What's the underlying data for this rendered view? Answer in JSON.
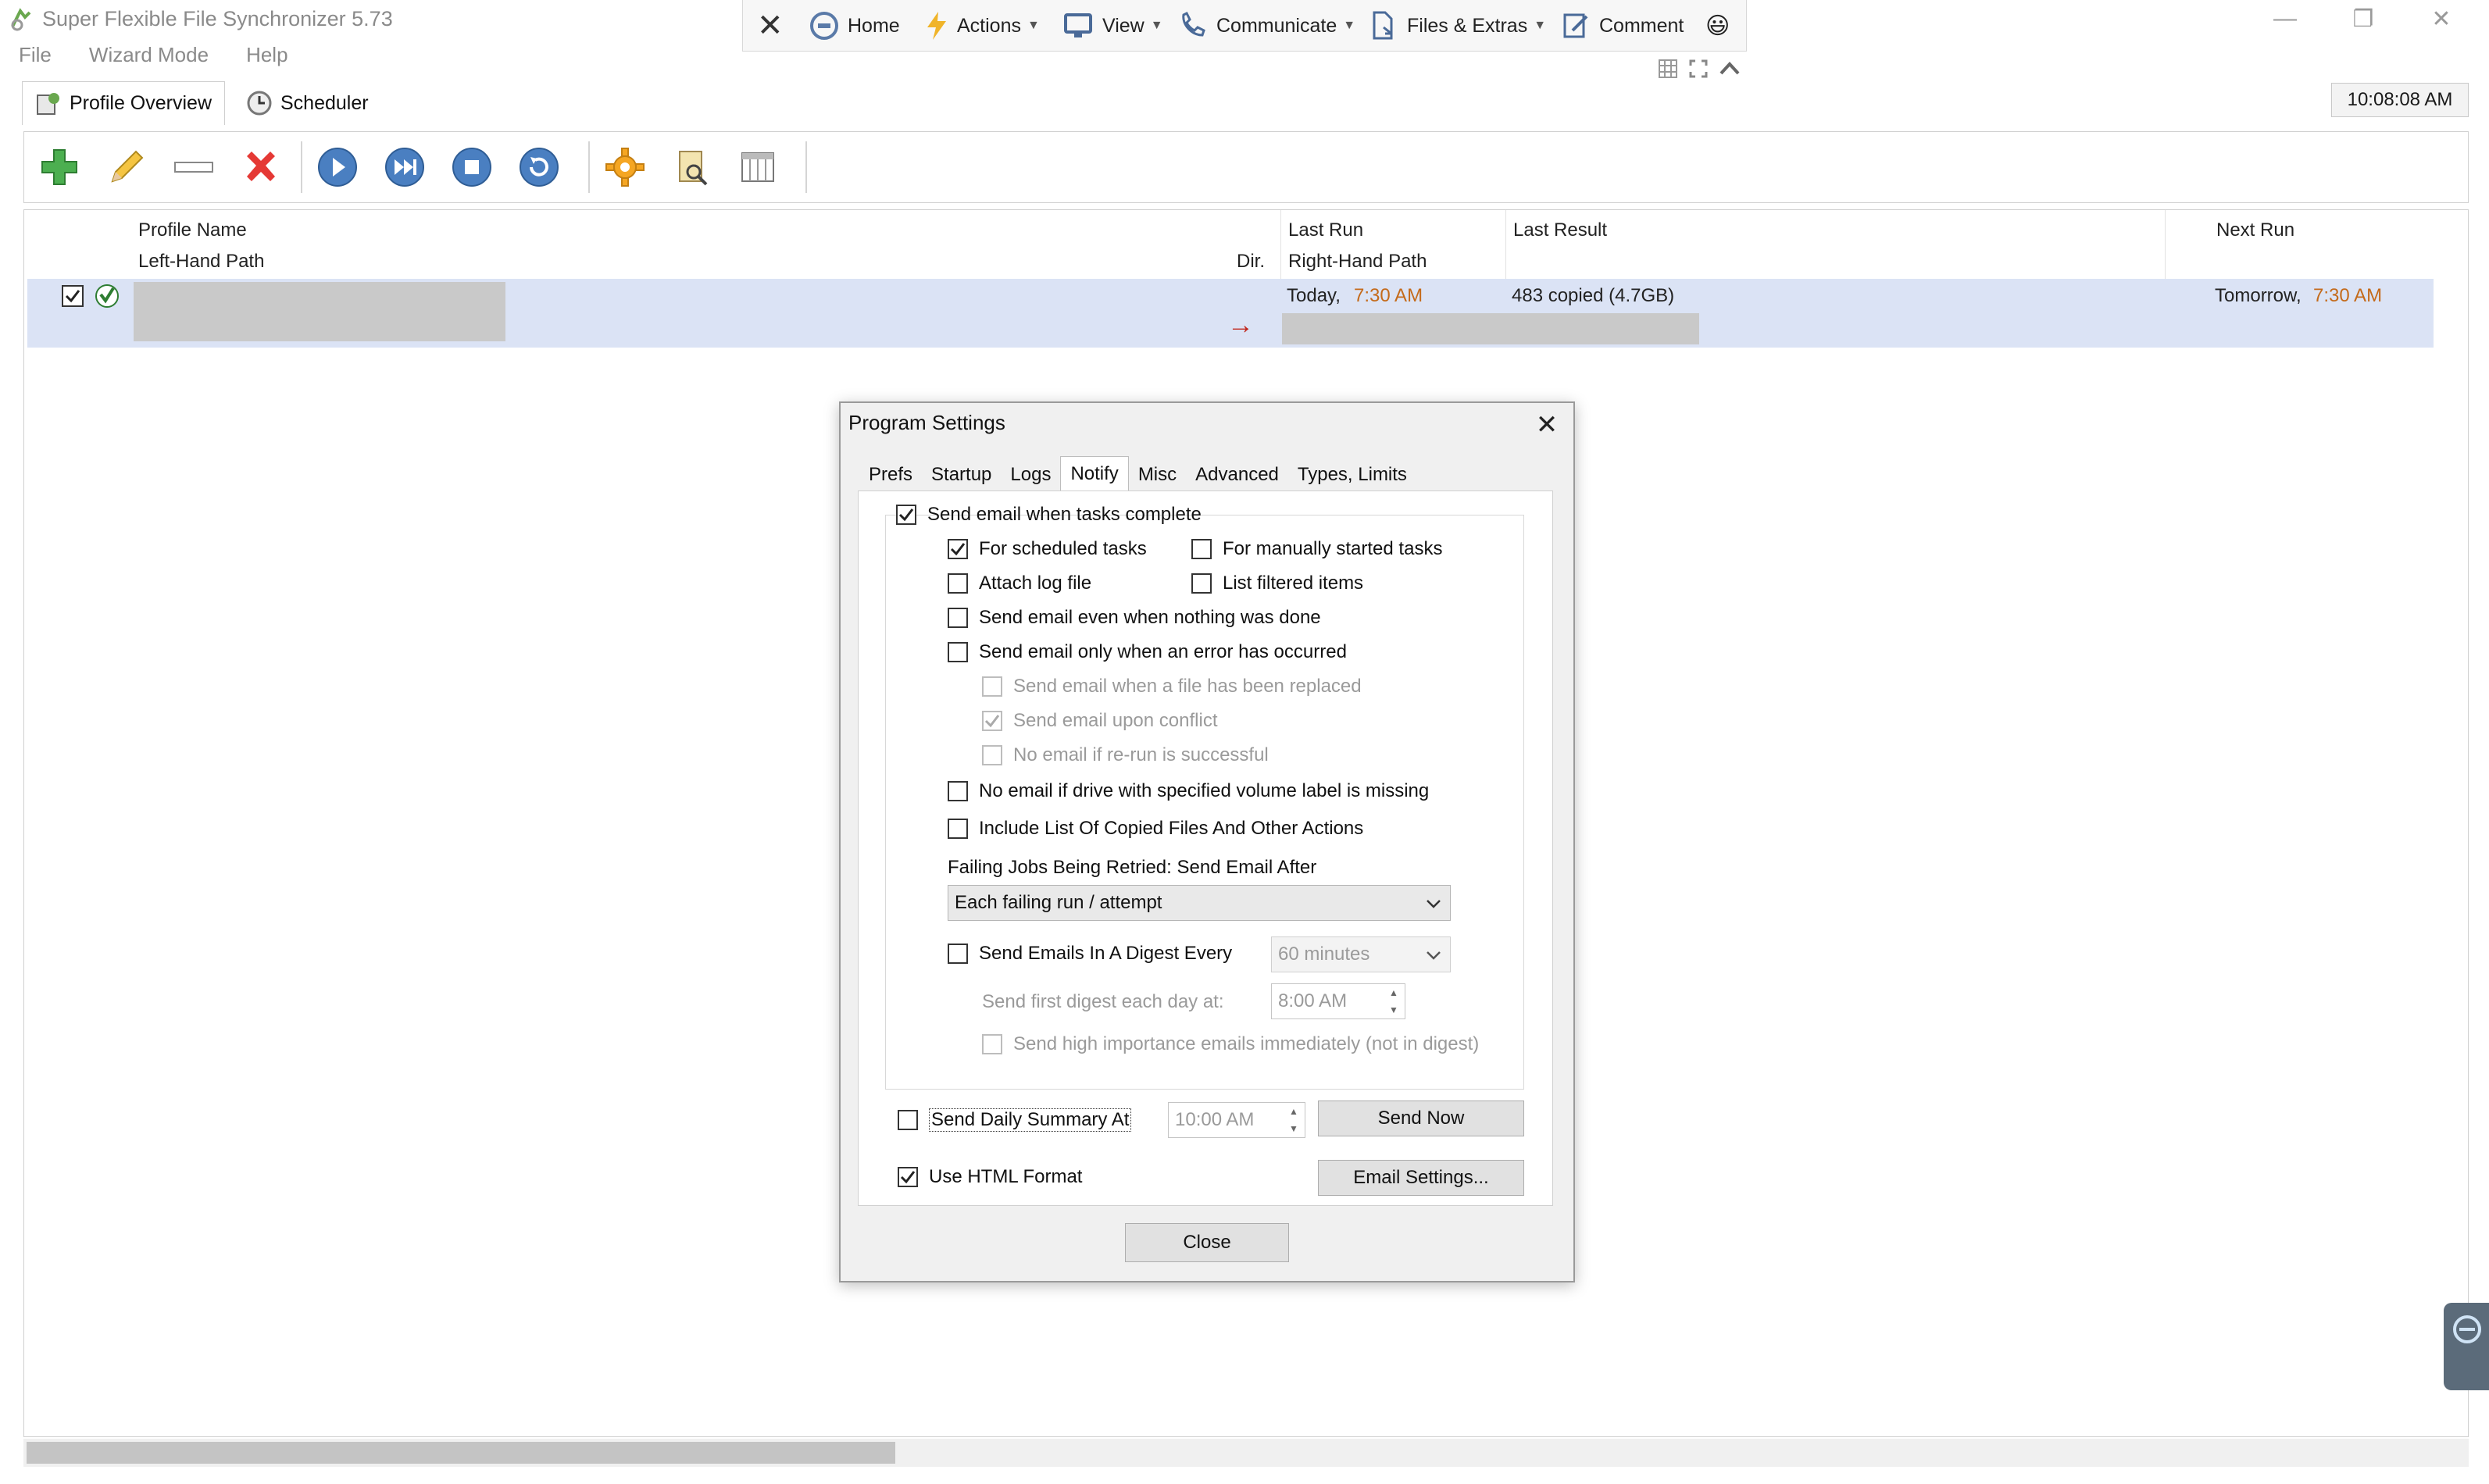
{
  "window": {
    "title": "Super Flexible File Synchronizer 5.73",
    "minimize_glyph": "—",
    "restore_glyph": "❐",
    "close_glyph": "✕"
  },
  "floating_toolbar": {
    "close_glyph": "✕",
    "items": [
      {
        "label": "Home",
        "icon": "home-icon"
      },
      {
        "label": "Actions",
        "icon": "lightning-icon",
        "dropdown": true
      },
      {
        "label": "View",
        "icon": "monitor-icon",
        "dropdown": true
      },
      {
        "label": "Communicate",
        "icon": "phone-icon",
        "dropdown": true
      },
      {
        "label": "Files & Extras",
        "icon": "file-icon",
        "dropdown": true
      },
      {
        "label": "Comment",
        "icon": "edit-icon"
      }
    ],
    "emoji": "😃"
  },
  "menu": [
    "File",
    "Wizard Mode",
    "Help"
  ],
  "view_tabs": {
    "profile_overview": "Profile Overview",
    "scheduler": "Scheduler"
  },
  "clock": "10:08:08 AM",
  "grid": {
    "headers": {
      "profile_name": "Profile Name",
      "left_path": "Left-Hand Path",
      "dir": "Dir.",
      "last_run": "Last Run",
      "right_path": "Right-Hand Path",
      "last_result": "Last Result",
      "next_run": "Next Run"
    },
    "rows": [
      {
        "checked": true,
        "last_run_day": "Today,",
        "last_run_time": "7:30 AM",
        "last_result": "483 copied (4.7GB)",
        "next_run_day": "Tomorrow,",
        "next_run_time": "7:30 AM",
        "direction": "→"
      }
    ]
  },
  "dialog": {
    "title": "Program Settings",
    "close_glyph": "✕",
    "tabs": [
      "Prefs",
      "Startup",
      "Logs",
      "Notify",
      "Misc",
      "Advanced",
      "Types, Limits"
    ],
    "active_tab": "Notify",
    "options": {
      "send_email_complete": {
        "label": "Send email when tasks complete",
        "checked": true
      },
      "for_scheduled": {
        "label": "For scheduled tasks",
        "checked": true
      },
      "for_manual": {
        "label": "For manually started tasks",
        "checked": false
      },
      "attach_log": {
        "label": "Attach log file",
        "checked": false
      },
      "list_filtered": {
        "label": "List filtered items",
        "checked": false
      },
      "send_nothing_done": {
        "label": "Send email even when nothing was done",
        "checked": false
      },
      "send_only_error": {
        "label": "Send email only when an error has occurred",
        "checked": false
      },
      "send_file_replaced": {
        "label": "Send email when a file has been replaced",
        "checked": false
      },
      "send_conflict": {
        "label": "Send email upon conflict",
        "checked": true
      },
      "no_email_rerun": {
        "label": "No email if re-run is successful",
        "checked": false
      },
      "no_email_volume": {
        "label": "No email if drive with specified volume label is missing",
        "checked": false
      },
      "include_list": {
        "label": "Include List Of Copied Files And Other Actions",
        "checked": false
      },
      "digest": {
        "label": "Send Emails In A Digest Every",
        "checked": false
      },
      "high_importance": {
        "label": "Send high importance emails immediately (not in digest)",
        "checked": false
      },
      "daily_summary": {
        "label": "Send Daily Summary At",
        "checked": false
      },
      "html_format": {
        "label": "Use HTML Format",
        "checked": true
      }
    },
    "failing_label": "Failing Jobs Being Retried: Send Email After",
    "failing_value": "Each failing run / attempt",
    "digest_interval": "60 minutes",
    "first_digest_label": "Send first digest each day at:",
    "first_digest_time": "8:00 AM",
    "daily_summary_time": "10:00 AM",
    "buttons": {
      "send_now": "Send Now",
      "email_settings": "Email Settings...",
      "close": "Close"
    }
  }
}
